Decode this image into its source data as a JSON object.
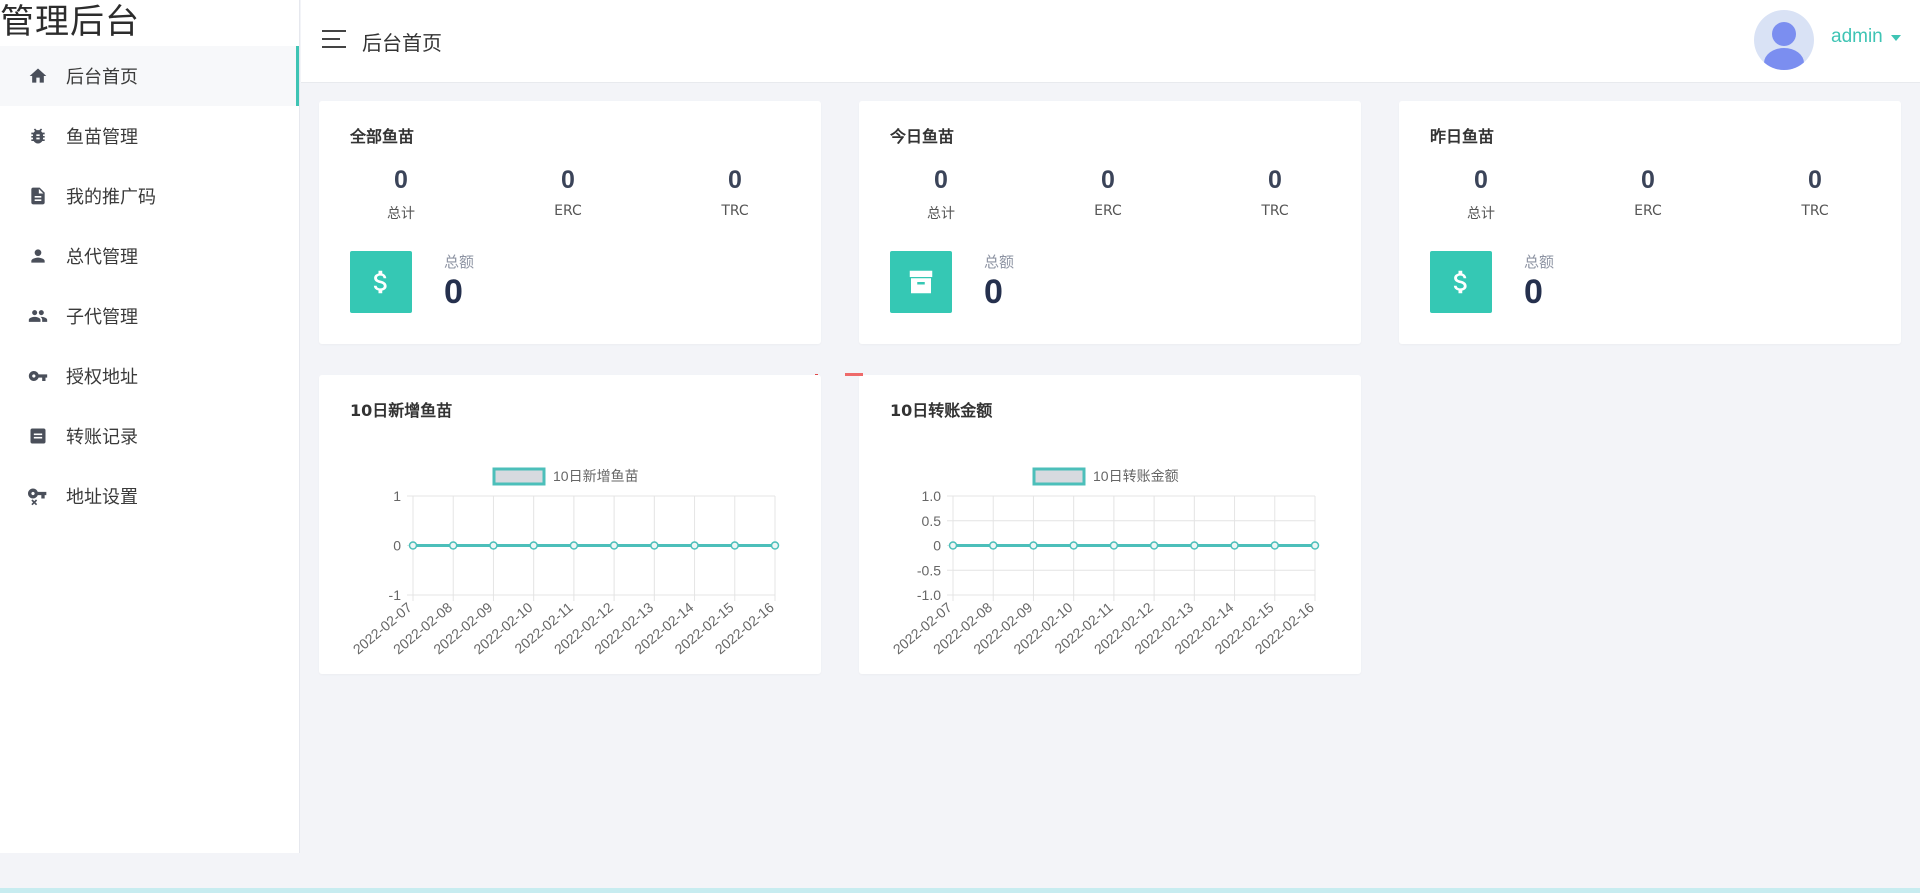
{
  "app": {
    "logo": "管理后台"
  },
  "sidebar": {
    "items": [
      {
        "label": "后台首页",
        "icon": "home-icon",
        "active": true
      },
      {
        "label": "鱼苗管理",
        "icon": "bug-icon",
        "active": false
      },
      {
        "label": "我的推广码",
        "icon": "document-icon",
        "active": false
      },
      {
        "label": "总代管理",
        "icon": "person-icon",
        "active": false
      },
      {
        "label": "子代管理",
        "icon": "people-icon",
        "active": false
      },
      {
        "label": "授权地址",
        "icon": "key-icon",
        "active": false
      },
      {
        "label": "转账记录",
        "icon": "receipt-icon",
        "active": false
      },
      {
        "label": "地址设置",
        "icon": "key-settings-icon",
        "active": false
      }
    ]
  },
  "header": {
    "title": "后台首页",
    "user_name": "admin"
  },
  "colors": {
    "accent": "#3ec4b4",
    "icon_bg": "#35c8b4",
    "line": "#4cbfba",
    "page_bg": "#f3f4f8"
  },
  "cards": [
    {
      "title": "全部鱼苗",
      "stats": [
        {
          "value": "0",
          "label": "总计"
        },
        {
          "value": "0",
          "label": "ERC"
        },
        {
          "value": "0",
          "label": "TRC"
        }
      ],
      "total_label": "总额",
      "total_value": "0",
      "icon": "dollar-icon"
    },
    {
      "title": "今日鱼苗",
      "stats": [
        {
          "value": "0",
          "label": "总计"
        },
        {
          "value": "0",
          "label": "ERC"
        },
        {
          "value": "0",
          "label": "TRC"
        }
      ],
      "total_label": "总额",
      "total_value": "0",
      "icon": "archive-icon"
    },
    {
      "title": "昨日鱼苗",
      "stats": [
        {
          "value": "0",
          "label": "总计"
        },
        {
          "value": "0",
          "label": "ERC"
        },
        {
          "value": "0",
          "label": "TRC"
        }
      ],
      "total_label": "总额",
      "total_value": "0",
      "icon": "dollar-icon"
    }
  ],
  "chart_cards": [
    {
      "title": "10日新增鱼苗"
    },
    {
      "title": "10日转账金额"
    }
  ],
  "chart_data": [
    {
      "type": "line",
      "legend": "10日新增鱼苗",
      "legend_position": "top-center",
      "x": [
        "2022-02-07",
        "2022-02-08",
        "2022-02-09",
        "2022-02-10",
        "2022-02-11",
        "2022-02-12",
        "2022-02-13",
        "2022-02-14",
        "2022-02-15",
        "2022-02-16"
      ],
      "series": [
        {
          "name": "10日新增鱼苗",
          "values": [
            0,
            0,
            0,
            0,
            0,
            0,
            0,
            0,
            0,
            0
          ]
        }
      ],
      "ylim": [
        -1,
        1
      ],
      "yticks": [
        "1",
        "0",
        "-1"
      ],
      "grid": true
    },
    {
      "type": "line",
      "legend": "10日转账金额",
      "legend_position": "top-center",
      "x": [
        "2022-02-07",
        "2022-02-08",
        "2022-02-09",
        "2022-02-10",
        "2022-02-11",
        "2022-02-12",
        "2022-02-13",
        "2022-02-14",
        "2022-02-15",
        "2022-02-16"
      ],
      "series": [
        {
          "name": "10日转账金额",
          "values": [
            0,
            0,
            0,
            0,
            0,
            0,
            0,
            0,
            0,
            0
          ]
        }
      ],
      "ylim": [
        -1.0,
        1.0
      ],
      "yticks": [
        "1.0",
        "0.5",
        "0",
        "-0.5",
        "-1.0"
      ],
      "grid": true
    }
  ]
}
